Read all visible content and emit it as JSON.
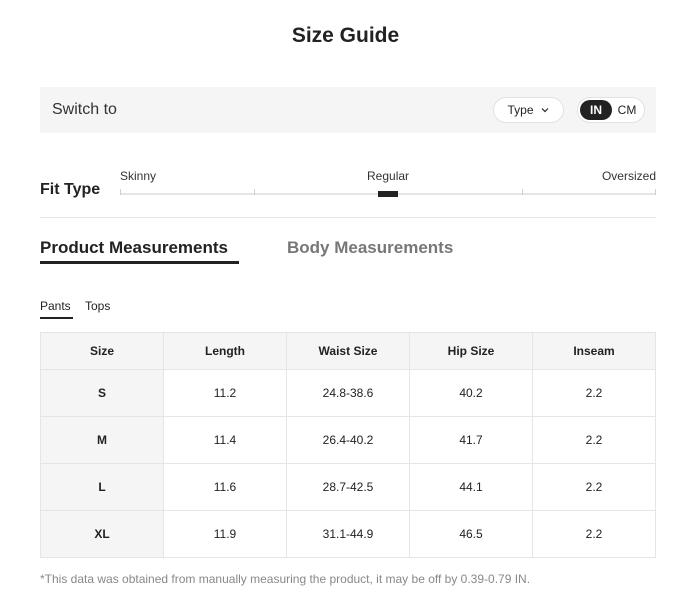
{
  "title": "Size Guide",
  "switch_bar": {
    "label": "Switch to",
    "type_button": "Type",
    "units": {
      "active": "IN",
      "inactive": "CM"
    }
  },
  "fit": {
    "title": "Fit Type",
    "options": [
      "Skinny",
      "Regular",
      "Oversized"
    ],
    "selected": "Regular"
  },
  "tabs": {
    "active": "Product Measurements",
    "inactive": "Body Measurements"
  },
  "sub_tabs": {
    "active": "Pants",
    "inactive": "Tops"
  },
  "table": {
    "headers": [
      "Size",
      "Length",
      "Waist Size",
      "Hip Size",
      "Inseam"
    ],
    "rows": [
      [
        "S",
        "11.2",
        "24.8-38.6",
        "40.2",
        "2.2"
      ],
      [
        "M",
        "11.4",
        "26.4-40.2",
        "41.7",
        "2.2"
      ],
      [
        "L",
        "11.6",
        "28.7-42.5",
        "44.1",
        "2.2"
      ],
      [
        "XL",
        "11.9",
        "31.1-44.9",
        "46.5",
        "2.2"
      ]
    ]
  },
  "footnote": "*This data was obtained from manually measuring the product, it may be off by 0.39-0.79 IN."
}
